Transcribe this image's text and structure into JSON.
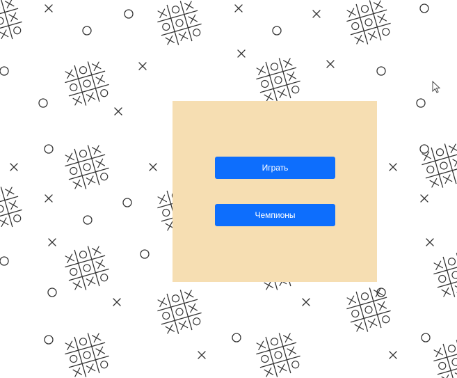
{
  "menu": {
    "play_label": "Играть",
    "champions_label": "Чемпионы"
  },
  "colors": {
    "panel_background": "#f6deb2",
    "button_background": "#0d6efd",
    "button_text": "#ffffff",
    "pattern_stroke": "#333333",
    "page_background": "#ffffff"
  },
  "background_pattern": {
    "icons": [
      "tic-tac-toe-board-icon",
      "cross-icon",
      "circle-icon"
    ]
  }
}
